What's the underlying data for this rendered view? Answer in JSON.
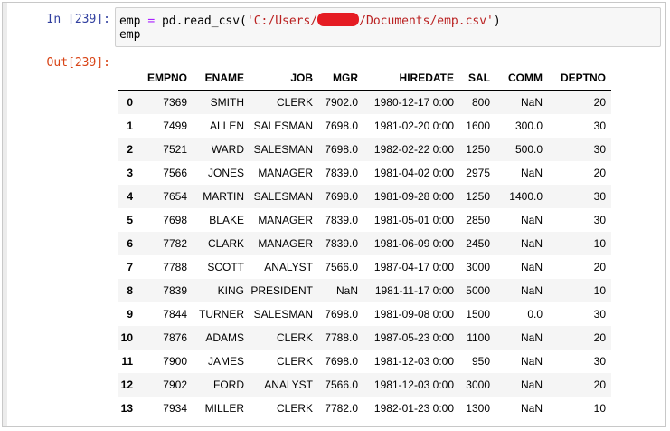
{
  "cell": {
    "in_prompt": "In [239]:",
    "out_prompt": "Out[239]:",
    "code": {
      "line1_var": "emp",
      "line1_op": "=",
      "line1_call": "pd.read_csv(",
      "line1_str_pre": "'C:/Users/",
      "line1_str_post": "/Documents/emp.csv'",
      "line1_close": ")",
      "line2": "emp"
    }
  },
  "table": {
    "columns": [
      "EMPNO",
      "ENAME",
      "JOB",
      "MGR",
      "HIREDATE",
      "SAL",
      "COMM",
      "DEPTNO"
    ],
    "rows": [
      {
        "idx": "0",
        "cells": [
          "7369",
          "SMITH",
          "CLERK",
          "7902.0",
          "1980-12-17 0:00",
          "800",
          "NaN",
          "20"
        ]
      },
      {
        "idx": "1",
        "cells": [
          "7499",
          "ALLEN",
          "SALESMAN",
          "7698.0",
          "1981-02-20 0:00",
          "1600",
          "300.0",
          "30"
        ]
      },
      {
        "idx": "2",
        "cells": [
          "7521",
          "WARD",
          "SALESMAN",
          "7698.0",
          "1982-02-22 0:00",
          "1250",
          "500.0",
          "30"
        ]
      },
      {
        "idx": "3",
        "cells": [
          "7566",
          "JONES",
          "MANAGER",
          "7839.0",
          "1981-04-02 0:00",
          "2975",
          "NaN",
          "20"
        ]
      },
      {
        "idx": "4",
        "cells": [
          "7654",
          "MARTIN",
          "SALESMAN",
          "7698.0",
          "1981-09-28 0:00",
          "1250",
          "1400.0",
          "30"
        ]
      },
      {
        "idx": "5",
        "cells": [
          "7698",
          "BLAKE",
          "MANAGER",
          "7839.0",
          "1981-05-01 0:00",
          "2850",
          "NaN",
          "30"
        ]
      },
      {
        "idx": "6",
        "cells": [
          "7782",
          "CLARK",
          "MANAGER",
          "7839.0",
          "1981-06-09 0:00",
          "2450",
          "NaN",
          "10"
        ]
      },
      {
        "idx": "7",
        "cells": [
          "7788",
          "SCOTT",
          "ANALYST",
          "7566.0",
          "1987-04-17 0:00",
          "3000",
          "NaN",
          "20"
        ]
      },
      {
        "idx": "8",
        "cells": [
          "7839",
          "KING",
          "PRESIDENT",
          "NaN",
          "1981-11-17 0:00",
          "5000",
          "NaN",
          "10"
        ]
      },
      {
        "idx": "9",
        "cells": [
          "7844",
          "TURNER",
          "SALESMAN",
          "7698.0",
          "1981-09-08 0:00",
          "1500",
          "0.0",
          "30"
        ]
      },
      {
        "idx": "10",
        "cells": [
          "7876",
          "ADAMS",
          "CLERK",
          "7788.0",
          "1987-05-23 0:00",
          "1100",
          "NaN",
          "20"
        ]
      },
      {
        "idx": "11",
        "cells": [
          "7900",
          "JAMES",
          "CLERK",
          "7698.0",
          "1981-12-03 0:00",
          "950",
          "NaN",
          "30"
        ]
      },
      {
        "idx": "12",
        "cells": [
          "7902",
          "FORD",
          "ANALYST",
          "7566.0",
          "1981-12-03 0:00",
          "3000",
          "NaN",
          "20"
        ]
      },
      {
        "idx": "13",
        "cells": [
          "7934",
          "MILLER",
          "CLERK",
          "7782.0",
          "1982-01-23 0:00",
          "1300",
          "NaN",
          "10"
        ]
      }
    ]
  },
  "colors": {
    "in_prompt": "#303f9f",
    "out_prompt": "#d84315",
    "string": "#ba2121",
    "operator": "#aa22ff",
    "redaction": "#e51c23"
  }
}
